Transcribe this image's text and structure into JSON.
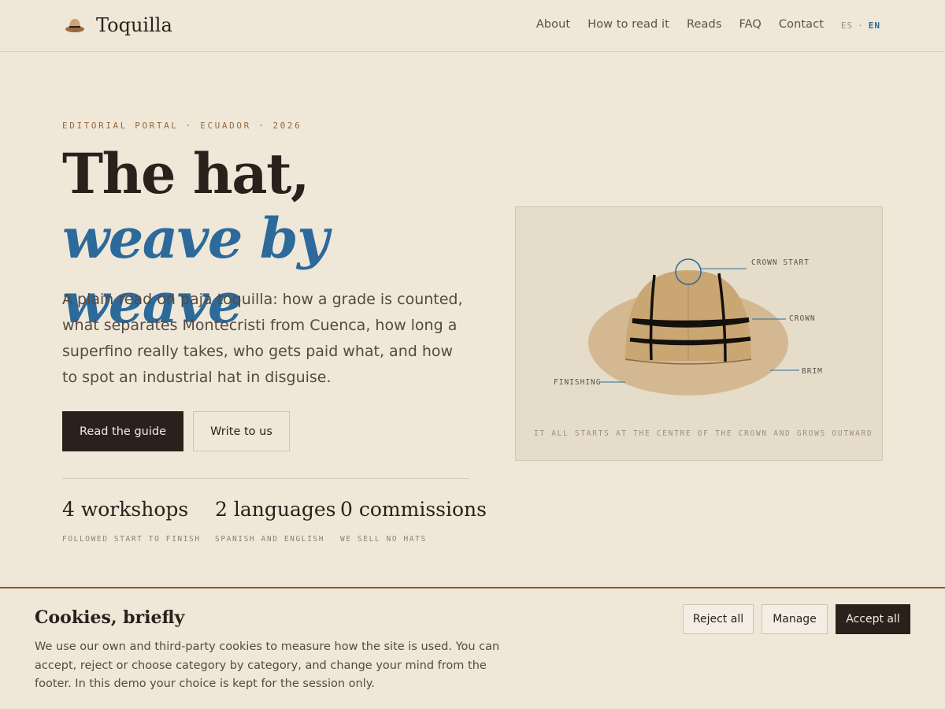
{
  "header": {
    "brand": "Toquilla",
    "brand_icon": "hat-icon",
    "nav": [
      "About",
      "How to read it",
      "Reads",
      "FAQ",
      "Contact"
    ],
    "lang_es": "ES",
    "lang_sep": "·",
    "lang_en": "EN",
    "active_lang": "EN"
  },
  "hero": {
    "eyebrow": "EDITORIAL PORTAL · ECUADOR · 2026",
    "headline_plain": "The hat, ",
    "headline_accent": "weave by weave",
    "lede": "A plain read on paja toquilla: how a grade is counted, what separates Montecristi from Cuenca, how long a superfino really takes, who gets paid what, and how to spot an industrial hat in disguise.",
    "primary_cta": "Read the guide",
    "secondary_cta": "Write to us",
    "stats": [
      {
        "value": "4 workshops",
        "label": "FOLLOWED START TO FINISH"
      },
      {
        "value": "2 languages",
        "label": "SPANISH AND ENGLISH"
      },
      {
        "value": "0 commissions",
        "label": "WE SELL NO HATS"
      }
    ]
  },
  "figure": {
    "labels": {
      "crown_start": "CROWN START",
      "crown": "CROWN",
      "brim": "BRIM",
      "finishing": "FINISHING"
    },
    "caption": "IT ALL STARTS AT THE CENTRE OF THE CROWN AND GROWS OUTWARD"
  },
  "cookie": {
    "title": "Cookies, briefly",
    "text": "We use our own and third-party cookies to measure how the site is used. You can accept, reject or choose category by category, and change your mind from the footer. In this demo your choice is kept for the session only.",
    "reject": "Reject all",
    "manage": "Manage",
    "accept": "Accept all"
  },
  "colors": {
    "background": "#efe7d8",
    "ink": "#2a211c",
    "accent_blue": "#2b6a9b",
    "eyebrow_brown": "#9a6a3e",
    "straw": "#c9a672"
  }
}
